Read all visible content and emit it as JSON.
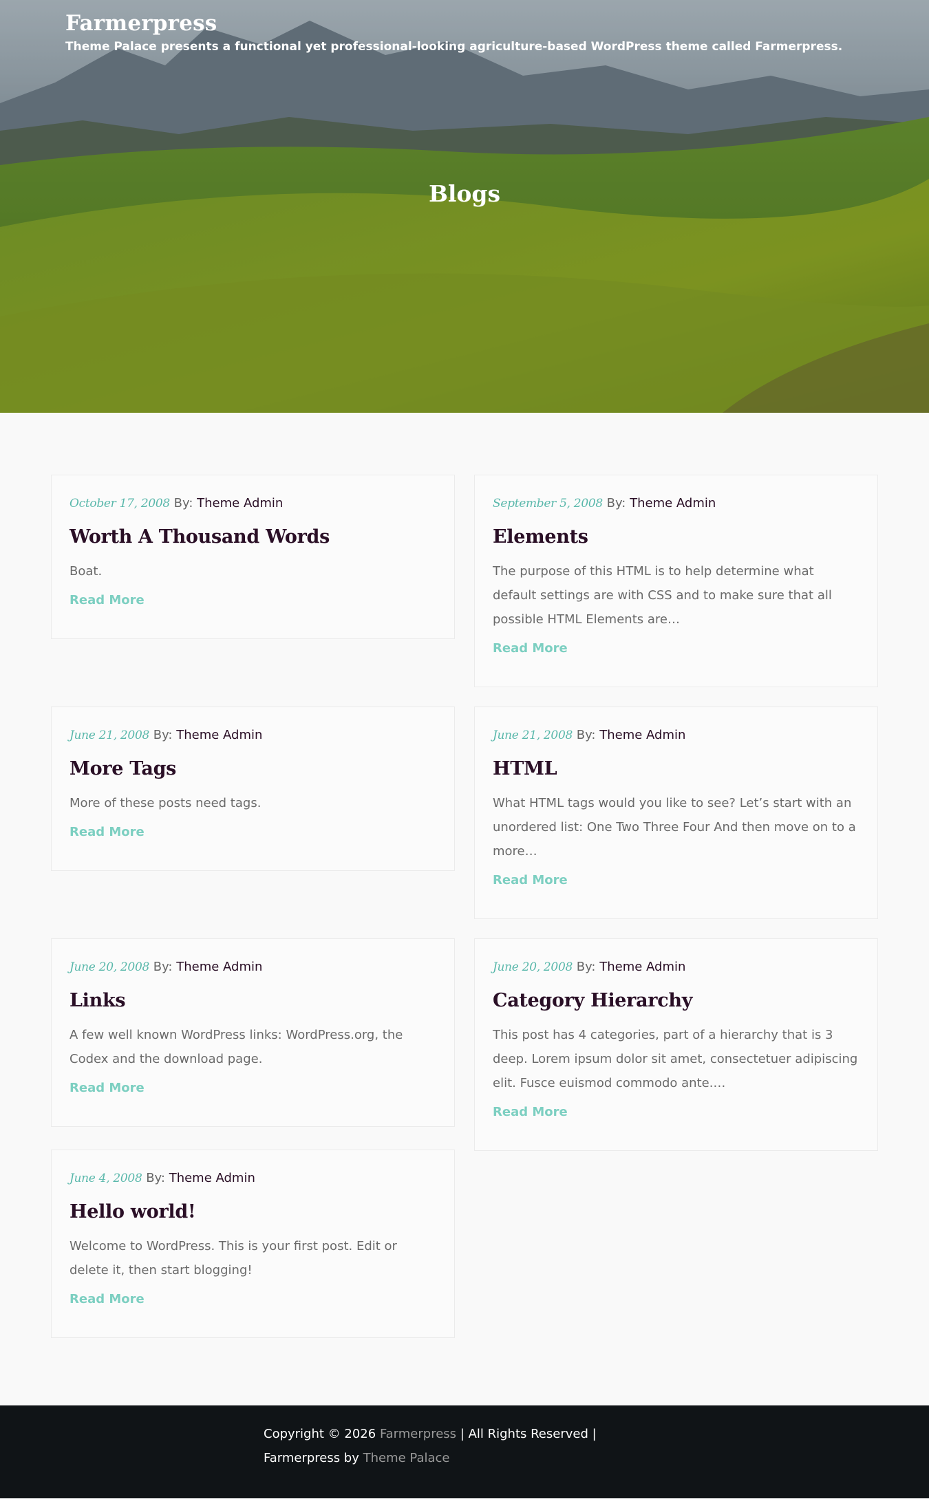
{
  "site": {
    "title": "Farmerpress",
    "description": "Theme Palace presents a functional yet professional-looking agriculture-based WordPress theme called Farmerpress."
  },
  "page": {
    "title": "Blogs"
  },
  "meta_labels": {
    "by": "By:",
    "read_more": "Read More"
  },
  "posts": [
    {
      "date": "October 17, 2008",
      "author": "Theme Admin",
      "title": "Worth A Thousand Words",
      "excerpt": "Boat."
    },
    {
      "date": "September 5, 2008",
      "author": "Theme Admin",
      "title": "Elements",
      "excerpt": "The purpose of this HTML is to help determine what default settings are with CSS and to make sure that all possible HTML Elements are…"
    },
    {
      "date": "June 21, 2008",
      "author": "Theme Admin",
      "title": "More Tags",
      "excerpt": "More of these posts need tags."
    },
    {
      "date": "June 21, 2008",
      "author": "Theme Admin",
      "title": "HTML",
      "excerpt": "What HTML tags would you like to see? Let’s start with an unordered list: One Two Three Four And then move on to a more…"
    },
    {
      "date": "June 20, 2008",
      "author": "Theme Admin",
      "title": "Links",
      "excerpt": "A few well known WordPress links: WordPress.org, the Codex and the download page."
    },
    {
      "date": "June 20, 2008",
      "author": "Theme Admin",
      "title": "Category Hierarchy",
      "excerpt": "This post has 4 categories, part of a hierarchy that is 3 deep. Lorem ipsum dolor sit amet, consectetuer adipiscing elit. Fusce euismod commodo ante.…"
    },
    {
      "date": "June 4, 2008",
      "author": "Theme Admin",
      "title": "Hello world!",
      "excerpt": "Welcome to WordPress. This is your first post. Edit or delete it, then start blogging!"
    }
  ],
  "footer": {
    "copyright_prefix": "Copyright © 2026",
    "site_link": "Farmerpress",
    "rights": "| All Rights Reserved |",
    "theme_name": "Farmerpress by",
    "author_link": "Theme Palace"
  },
  "colors": {
    "accent": "#7ccfc1",
    "date": "#5ab8ab",
    "heading": "#2a0f26",
    "footer_bg": "#101417"
  }
}
